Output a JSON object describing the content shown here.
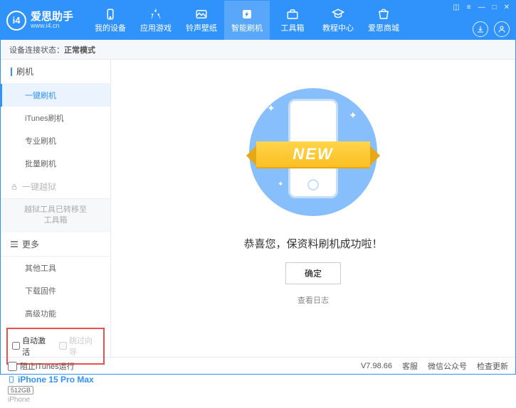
{
  "app": {
    "title": "爱思助手",
    "subtitle": "www.i4.cn"
  },
  "nav": [
    {
      "label": "我的设备"
    },
    {
      "label": "应用游戏"
    },
    {
      "label": "铃声壁纸"
    },
    {
      "label": "智能刷机"
    },
    {
      "label": "工具箱"
    },
    {
      "label": "教程中心"
    },
    {
      "label": "爱思商城"
    }
  ],
  "active_nav": 3,
  "status": {
    "prefix": "设备连接状态：",
    "value": "正常模式"
  },
  "sidebar": {
    "group_flash": "刷机",
    "items_flash": [
      {
        "label": "一键刷机"
      },
      {
        "label": "iTunes刷机"
      },
      {
        "label": "专业刷机"
      },
      {
        "label": "批量刷机"
      }
    ],
    "group_jailbreak": "一键越狱",
    "jailbreak_note": "越狱工具已转移至\n工具箱",
    "group_more": "更多",
    "items_more": [
      {
        "label": "其他工具"
      },
      {
        "label": "下载固件"
      },
      {
        "label": "高级功能"
      }
    ],
    "chk_auto_activate": "自动激活",
    "chk_skip_guide": "跳过向导"
  },
  "device": {
    "name": "iPhone 15 Pro Max",
    "storage": "512GB",
    "type": "iPhone"
  },
  "main": {
    "ribbon": "NEW",
    "success": "恭喜您，保资料刷机成功啦！",
    "ok": "确定",
    "view_log": "查看日志"
  },
  "footer": {
    "block_itunes": "阻止iTunes运行",
    "version": "V7.98.66",
    "links": [
      "客服",
      "微信公众号",
      "检查更新"
    ]
  }
}
